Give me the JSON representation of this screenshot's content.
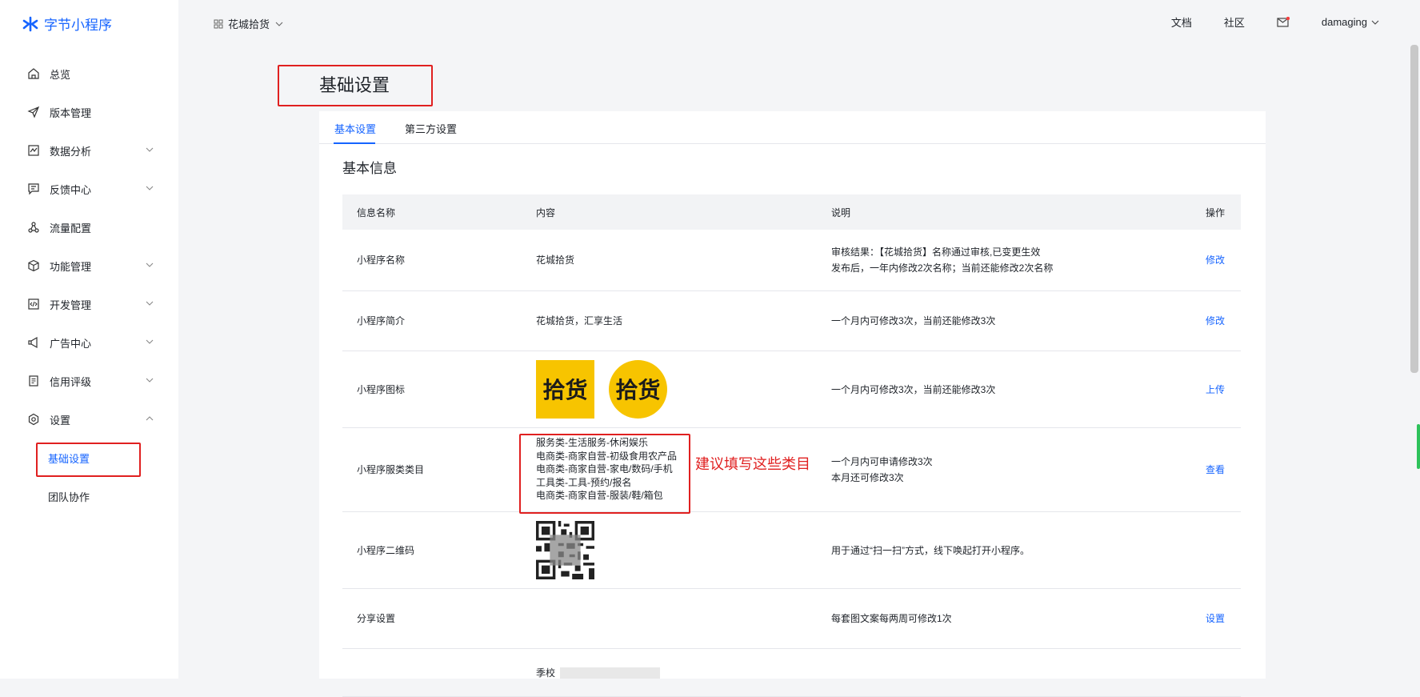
{
  "brand": {
    "name": "字节小程序"
  },
  "sidebar": {
    "items": [
      {
        "label": "总览",
        "icon": "home-icon"
      },
      {
        "label": "版本管理",
        "icon": "send-icon"
      },
      {
        "label": "数据分析",
        "icon": "chart-icon"
      },
      {
        "label": "反馈中心",
        "icon": "message-icon"
      },
      {
        "label": "流量配置",
        "icon": "flow-icon"
      },
      {
        "label": "功能管理",
        "icon": "box-icon"
      },
      {
        "label": "开发管理",
        "icon": "code-icon"
      },
      {
        "label": "广告中心",
        "icon": "megaphone-icon"
      },
      {
        "label": "信用评级",
        "icon": "doc-icon"
      },
      {
        "label": "设置",
        "icon": "gear-icon"
      }
    ],
    "sub_items": [
      "基础设置",
      "团队协作"
    ]
  },
  "topbar": {
    "app_name": "花城拾货",
    "docs": "文档",
    "community": "社区",
    "user": "damaging"
  },
  "page": {
    "title": "基础设置",
    "tabs": [
      "基本设置",
      "第三方设置"
    ],
    "section_title": "基本信息"
  },
  "table": {
    "headers": [
      "信息名称",
      "内容",
      "说明",
      "操作"
    ],
    "rows": [
      {
        "name": "小程序名称",
        "content": "花城拾货",
        "desc1": "审核结果：【花城拾货】名称通过审核,已变更生效",
        "desc2": "发布后，一年内修改2次名称；当前还能修改2次名称",
        "op": "修改"
      },
      {
        "name": "小程序简介",
        "content": "花城拾货，汇享生活",
        "desc1": "一个月内可修改3次，当前还能修改3次",
        "op": "修改"
      },
      {
        "name": "小程序图标",
        "logo_text": "拾货",
        "desc1": "一个月内可修改3次，当前还能修改3次",
        "op": "上传"
      },
      {
        "name": "小程序服类类目",
        "categories": [
          "服务类-生活服务-休闲娱乐",
          "电商类-商家自营-初级食用农产品",
          "电商类-商家自营-家电/数码/手机",
          "工具类-工具-预约/报名",
          "电商类-商家自营-服装/鞋/箱包"
        ],
        "desc1": "一个月内可申请修改3次",
        "desc2": "本月还可修改3次",
        "op": "查看"
      },
      {
        "name": "小程序二维码",
        "desc1": "用于通过“扫一扫”方式，线下唤起打开小程序。"
      },
      {
        "name": "分享设置",
        "desc1": "每套图文案每两周可修改1次",
        "op": "设置"
      },
      {
        "name": "",
        "content": "季校"
      }
    ]
  },
  "annotation": {
    "note": "建议填写这些类目"
  },
  "colors": {
    "accent": "#1664ff",
    "annotation_red": "#e02020",
    "logo_yellow": "#f7c400"
  }
}
